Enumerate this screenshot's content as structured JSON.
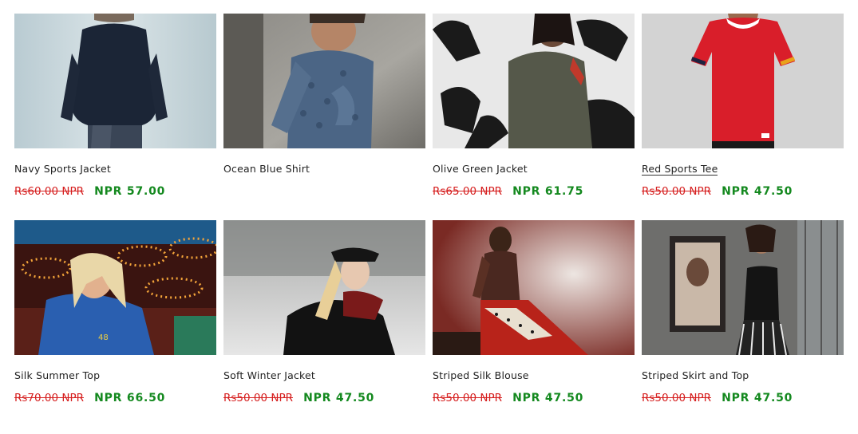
{
  "products": [
    {
      "title": "Navy Sports Jacket",
      "old_price": "Rs60.00 NPR",
      "new_price": "NPR 57.00",
      "image": "man-navy-jacket-back-photo"
    },
    {
      "title": "Ocean Blue Shirt",
      "old_price": "",
      "new_price": "",
      "image": "man-patterned-shirt-against-wall-photo"
    },
    {
      "title": "Olive Green Jacket",
      "old_price": "Rs65.00 NPR",
      "new_price": "NPR 61.75",
      "image": "woman-olive-jacket-graffiti-photo"
    },
    {
      "title": "Red Sports Tee",
      "old_price": "Rs50.00 NPR",
      "new_price": "NPR 47.50",
      "image": "woman-red-tee-photo"
    },
    {
      "title": "Silk Summer Top",
      "old_price": "Rs70.00 NPR",
      "new_price": "NPR 66.50",
      "image": "woman-blue-top-carnival-lights-photo"
    },
    {
      "title": "Soft Winter Jacket",
      "old_price": "Rs50.00 NPR",
      "new_price": "NPR 47.50",
      "image": "woman-winter-jacket-snow-photo"
    },
    {
      "title": "Striped Silk Blouse",
      "old_price": "Rs50.00 NPR",
      "new_price": "NPR 47.50",
      "image": "woman-plaid-dress-seated-photo"
    },
    {
      "title": "Striped Skirt and Top",
      "old_price": "Rs50.00 NPR",
      "new_price": "NPR 47.50",
      "image": "woman-striped-skirt-black-top-photo"
    }
  ],
  "colors": {
    "sale_old": "#d61f1f",
    "sale_new": "#14891f",
    "title": "#222222"
  }
}
